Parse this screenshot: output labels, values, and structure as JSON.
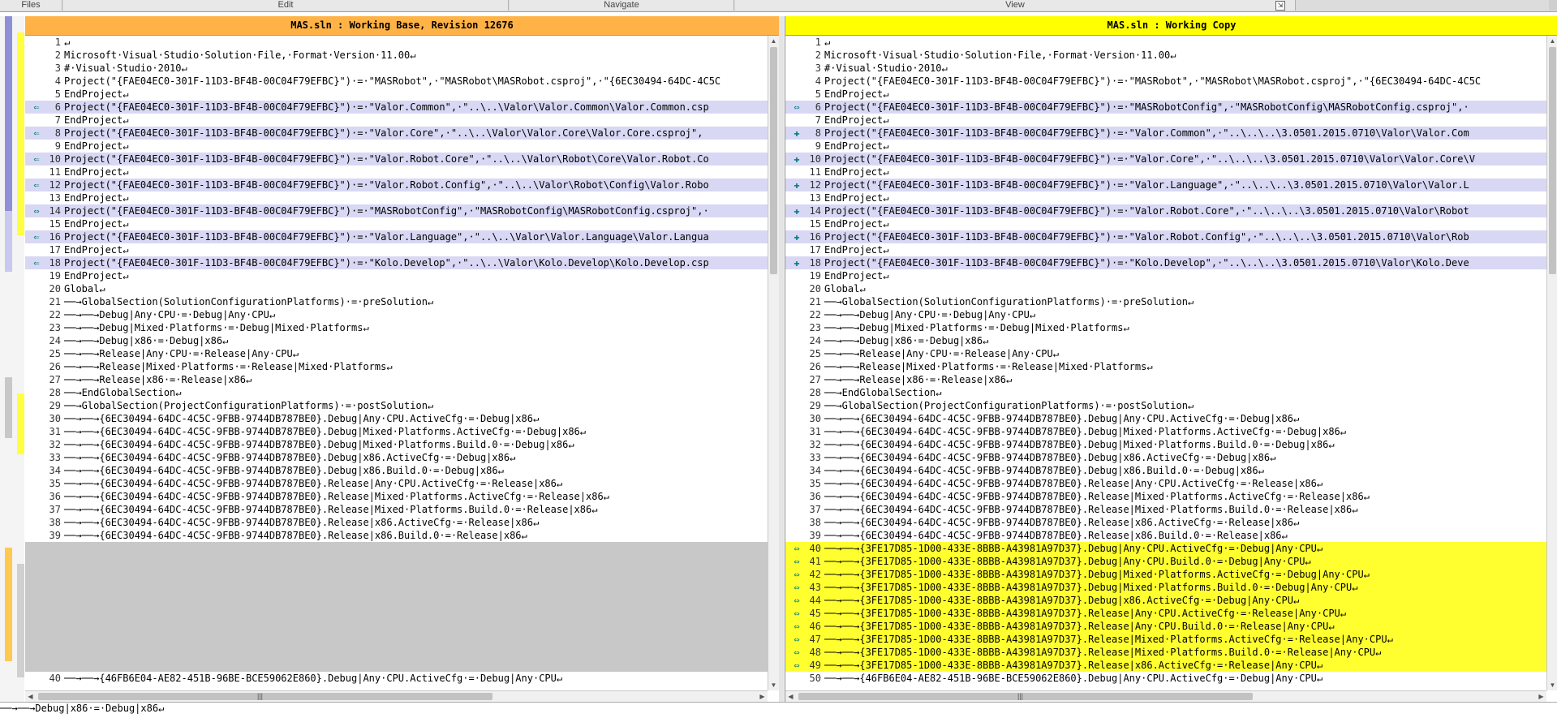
{
  "toolbar": {
    "groups": [
      {
        "label": "Files"
      },
      {
        "label": "Edit"
      },
      {
        "label": "Navigate"
      },
      {
        "label": "View"
      }
    ]
  },
  "left": {
    "title": "MAS.sln : Working Base, Revision 12676",
    "header_color": "#ffb347",
    "lines": [
      {
        "n": "1",
        "t": "↵",
        "k": ""
      },
      {
        "n": "2",
        "t": "Microsoft·Visual·Studio·Solution·File,·Format·Version·11.00↵",
        "k": ""
      },
      {
        "n": "3",
        "t": "#·Visual·Studio·2010↵",
        "k": ""
      },
      {
        "n": "4",
        "t": "Project(\"{FAE04EC0-301F-11D3-BF4B-00C04F79EFBC}\")·=·\"MASRobot\",·\"MASRobot\\MASRobot.csproj\",·\"{6EC30494-64DC-4C5C",
        "k": ""
      },
      {
        "n": "5",
        "t": "EndProject↵",
        "k": ""
      },
      {
        "n": "6",
        "t": "Project(\"{FAE04EC0-301F-11D3-BF4B-00C04F79EFBC}\")·=·\"Valor.Common\",·\"..\\..\\Valor\\Valor.Common\\Valor.Common.csp",
        "k": "mod",
        "g": "⇐"
      },
      {
        "n": "7",
        "t": "EndProject↵",
        "k": ""
      },
      {
        "n": "8",
        "t": "Project(\"{FAE04EC0-301F-11D3-BF4B-00C04F79EFBC}\")·=·\"Valor.Core\",·\"..\\..\\Valor\\Valor.Core\\Valor.Core.csproj\",",
        "k": "mod",
        "g": "⇐"
      },
      {
        "n": "9",
        "t": "EndProject↵",
        "k": ""
      },
      {
        "n": "10",
        "t": "Project(\"{FAE04EC0-301F-11D3-BF4B-00C04F79EFBC}\")·=·\"Valor.Robot.Core\",·\"..\\..\\Valor\\Robot\\Core\\Valor.Robot.Co",
        "k": "mod",
        "g": "⇐"
      },
      {
        "n": "11",
        "t": "EndProject↵",
        "k": ""
      },
      {
        "n": "12",
        "t": "Project(\"{FAE04EC0-301F-11D3-BF4B-00C04F79EFBC}\")·=·\"Valor.Robot.Config\",·\"..\\..\\Valor\\Robot\\Config\\Valor.Robo",
        "k": "mod",
        "g": "⇐"
      },
      {
        "n": "13",
        "t": "EndProject↵",
        "k": ""
      },
      {
        "n": "14",
        "t": "Project(\"{FAE04EC0-301F-11D3-BF4B-00C04F79EFBC}\")·=·\"MASRobotConfig\",·\"MASRobotConfig\\MASRobotConfig.csproj\",·",
        "k": "mod",
        "g": "⇔"
      },
      {
        "n": "15",
        "t": "EndProject↵",
        "k": ""
      },
      {
        "n": "16",
        "t": "Project(\"{FAE04EC0-301F-11D3-BF4B-00C04F79EFBC}\")·=·\"Valor.Language\",·\"..\\..\\Valor\\Valor.Language\\Valor.Langua",
        "k": "mod",
        "g": "⇐"
      },
      {
        "n": "17",
        "t": "EndProject↵",
        "k": ""
      },
      {
        "n": "18",
        "t": "Project(\"{FAE04EC0-301F-11D3-BF4B-00C04F79EFBC}\")·=·\"Kolo.Develop\",·\"..\\..\\Valor\\Kolo.Develop\\Kolo.Develop.csp",
        "k": "mod",
        "g": "⇐"
      },
      {
        "n": "19",
        "t": "EndProject↵",
        "k": ""
      },
      {
        "n": "20",
        "t": "Global↵",
        "k": ""
      },
      {
        "n": "21",
        "t": "──→GlobalSection(SolutionConfigurationPlatforms)·=·preSolution↵",
        "k": ""
      },
      {
        "n": "22",
        "t": "──→──→Debug|Any·CPU·=·Debug|Any·CPU↵",
        "k": ""
      },
      {
        "n": "23",
        "t": "──→──→Debug|Mixed·Platforms·=·Debug|Mixed·Platforms↵",
        "k": ""
      },
      {
        "n": "24",
        "t": "──→──→Debug|x86·=·Debug|x86↵",
        "k": ""
      },
      {
        "n": "25",
        "t": "──→──→Release|Any·CPU·=·Release|Any·CPU↵",
        "k": ""
      },
      {
        "n": "26",
        "t": "──→──→Release|Mixed·Platforms·=·Release|Mixed·Platforms↵",
        "k": ""
      },
      {
        "n": "27",
        "t": "──→──→Release|x86·=·Release|x86↵",
        "k": ""
      },
      {
        "n": "28",
        "t": "──→EndGlobalSection↵",
        "k": ""
      },
      {
        "n": "29",
        "t": "──→GlobalSection(ProjectConfigurationPlatforms)·=·postSolution↵",
        "k": ""
      },
      {
        "n": "30",
        "t": "──→──→{6EC30494-64DC-4C5C-9FBB-9744DB787BE0}.Debug|Any·CPU.ActiveCfg·=·Debug|x86↵",
        "k": ""
      },
      {
        "n": "31",
        "t": "──→──→{6EC30494-64DC-4C5C-9FBB-9744DB787BE0}.Debug|Mixed·Platforms.ActiveCfg·=·Debug|x86↵",
        "k": ""
      },
      {
        "n": "32",
        "t": "──→──→{6EC30494-64DC-4C5C-9FBB-9744DB787BE0}.Debug|Mixed·Platforms.Build.0·=·Debug|x86↵",
        "k": ""
      },
      {
        "n": "33",
        "t": "──→──→{6EC30494-64DC-4C5C-9FBB-9744DB787BE0}.Debug|x86.ActiveCfg·=·Debug|x86↵",
        "k": ""
      },
      {
        "n": "34",
        "t": "──→──→{6EC30494-64DC-4C5C-9FBB-9744DB787BE0}.Debug|x86.Build.0·=·Debug|x86↵",
        "k": ""
      },
      {
        "n": "35",
        "t": "──→──→{6EC30494-64DC-4C5C-9FBB-9744DB787BE0}.Release|Any·CPU.ActiveCfg·=·Release|x86↵",
        "k": ""
      },
      {
        "n": "36",
        "t": "──→──→{6EC30494-64DC-4C5C-9FBB-9744DB787BE0}.Release|Mixed·Platforms.ActiveCfg·=·Release|x86↵",
        "k": ""
      },
      {
        "n": "37",
        "t": "──→──→{6EC30494-64DC-4C5C-9FBB-9744DB787BE0}.Release|Mixed·Platforms.Build.0·=·Release|x86↵",
        "k": ""
      },
      {
        "n": "38",
        "t": "──→──→{6EC30494-64DC-4C5C-9FBB-9744DB787BE0}.Release|x86.ActiveCfg·=·Release|x86↵",
        "k": ""
      },
      {
        "n": "39",
        "t": "──→──→{6EC30494-64DC-4C5C-9FBB-9744DB787BE0}.Release|x86.Build.0·=·Release|x86↵",
        "k": ""
      }
    ],
    "last_line": {
      "n": "40",
      "t": "──→──→{46FB6E04-AE82-451B-96BE-BCE59062E860}.Debug|Any·CPU.ActiveCfg·=·Debug|Any·CPU↵"
    }
  },
  "right": {
    "title": "MAS.sln : Working Copy",
    "header_color": "#ffff00",
    "lines": [
      {
        "n": "1",
        "t": "↵",
        "k": ""
      },
      {
        "n": "2",
        "t": "Microsoft·Visual·Studio·Solution·File,·Format·Version·11.00↵",
        "k": ""
      },
      {
        "n": "3",
        "t": "#·Visual·Studio·2010↵",
        "k": ""
      },
      {
        "n": "4",
        "t": "Project(\"{FAE04EC0-301F-11D3-BF4B-00C04F79EFBC}\")·=·\"MASRobot\",·\"MASRobot\\MASRobot.csproj\",·\"{6EC30494-64DC-4C5C",
        "k": ""
      },
      {
        "n": "5",
        "t": "EndProject↵",
        "k": ""
      },
      {
        "n": "6",
        "t": "Project(\"{FAE04EC0-301F-11D3-BF4B-00C04F79EFBC}\")·=·\"MASRobotConfig\",·\"MASRobotConfig\\MASRobotConfig.csproj\",·",
        "k": "mod",
        "g": "⇔"
      },
      {
        "n": "7",
        "t": "EndProject↵",
        "k": ""
      },
      {
        "n": "8",
        "t": "Project(\"{FAE04EC0-301F-11D3-BF4B-00C04F79EFBC}\")·=·\"Valor.Common\",·\"..\\..\\..\\3.0501.2015.0710\\Valor\\Valor.Com",
        "k": "mod",
        "g": "✚"
      },
      {
        "n": "9",
        "t": "EndProject↵",
        "k": ""
      },
      {
        "n": "10",
        "t": "Project(\"{FAE04EC0-301F-11D3-BF4B-00C04F79EFBC}\")·=·\"Valor.Core\",·\"..\\..\\..\\3.0501.2015.0710\\Valor\\Valor.Core\\V",
        "k": "mod",
        "g": "✚"
      },
      {
        "n": "11",
        "t": "EndProject↵",
        "k": ""
      },
      {
        "n": "12",
        "t": "Project(\"{FAE04EC0-301F-11D3-BF4B-00C04F79EFBC}\")·=·\"Valor.Language\",·\"..\\..\\..\\3.0501.2015.0710\\Valor\\Valor.L",
        "k": "mod",
        "g": "✚"
      },
      {
        "n": "13",
        "t": "EndProject↵",
        "k": ""
      },
      {
        "n": "14",
        "t": "Project(\"{FAE04EC0-301F-11D3-BF4B-00C04F79EFBC}\")·=·\"Valor.Robot.Core\",·\"..\\..\\..\\3.0501.2015.0710\\Valor\\Robot",
        "k": "mod",
        "g": "✚"
      },
      {
        "n": "15",
        "t": "EndProject↵",
        "k": ""
      },
      {
        "n": "16",
        "t": "Project(\"{FAE04EC0-301F-11D3-BF4B-00C04F79EFBC}\")·=·\"Valor.Robot.Config\",·\"..\\..\\..\\3.0501.2015.0710\\Valor\\Rob",
        "k": "mod",
        "g": "✚"
      },
      {
        "n": "17",
        "t": "EndProject↵",
        "k": ""
      },
      {
        "n": "18",
        "t": "Project(\"{FAE04EC0-301F-11D3-BF4B-00C04F79EFBC}\")·=·\"Kolo.Develop\",·\"..\\..\\..\\3.0501.2015.0710\\Valor\\Kolo.Deve",
        "k": "mod",
        "g": "✚"
      },
      {
        "n": "19",
        "t": "EndProject↵",
        "k": ""
      },
      {
        "n": "20",
        "t": "Global↵",
        "k": ""
      },
      {
        "n": "21",
        "t": "──→GlobalSection(SolutionConfigurationPlatforms)·=·preSolution↵",
        "k": ""
      },
      {
        "n": "22",
        "t": "──→──→Debug|Any·CPU·=·Debug|Any·CPU↵",
        "k": ""
      },
      {
        "n": "23",
        "t": "──→──→Debug|Mixed·Platforms·=·Debug|Mixed·Platforms↵",
        "k": ""
      },
      {
        "n": "24",
        "t": "──→──→Debug|x86·=·Debug|x86↵",
        "k": ""
      },
      {
        "n": "25",
        "t": "──→──→Release|Any·CPU·=·Release|Any·CPU↵",
        "k": ""
      },
      {
        "n": "26",
        "t": "──→──→Release|Mixed·Platforms·=·Release|Mixed·Platforms↵",
        "k": ""
      },
      {
        "n": "27",
        "t": "──→──→Release|x86·=·Release|x86↵",
        "k": ""
      },
      {
        "n": "28",
        "t": "──→EndGlobalSection↵",
        "k": ""
      },
      {
        "n": "29",
        "t": "──→GlobalSection(ProjectConfigurationPlatforms)·=·postSolution↵",
        "k": ""
      },
      {
        "n": "30",
        "t": "──→──→{6EC30494-64DC-4C5C-9FBB-9744DB787BE0}.Debug|Any·CPU.ActiveCfg·=·Debug|x86↵",
        "k": ""
      },
      {
        "n": "31",
        "t": "──→──→{6EC30494-64DC-4C5C-9FBB-9744DB787BE0}.Debug|Mixed·Platforms.ActiveCfg·=·Debug|x86↵",
        "k": ""
      },
      {
        "n": "32",
        "t": "──→──→{6EC30494-64DC-4C5C-9FBB-9744DB787BE0}.Debug|Mixed·Platforms.Build.0·=·Debug|x86↵",
        "k": ""
      },
      {
        "n": "33",
        "t": "──→──→{6EC30494-64DC-4C5C-9FBB-9744DB787BE0}.Debug|x86.ActiveCfg·=·Debug|x86↵",
        "k": ""
      },
      {
        "n": "34",
        "t": "──→──→{6EC30494-64DC-4C5C-9FBB-9744DB787BE0}.Debug|x86.Build.0·=·Debug|x86↵",
        "k": ""
      },
      {
        "n": "35",
        "t": "──→──→{6EC30494-64DC-4C5C-9FBB-9744DB787BE0}.Release|Any·CPU.ActiveCfg·=·Release|x86↵",
        "k": ""
      },
      {
        "n": "36",
        "t": "──→──→{6EC30494-64DC-4C5C-9FBB-9744DB787BE0}.Release|Mixed·Platforms.ActiveCfg·=·Release|x86↵",
        "k": ""
      },
      {
        "n": "37",
        "t": "──→──→{6EC30494-64DC-4C5C-9FBB-9744DB787BE0}.Release|Mixed·Platforms.Build.0·=·Release|x86↵",
        "k": ""
      },
      {
        "n": "38",
        "t": "──→──→{6EC30494-64DC-4C5C-9FBB-9744DB787BE0}.Release|x86.ActiveCfg·=·Release|x86↵",
        "k": ""
      },
      {
        "n": "39",
        "t": "──→──→{6EC30494-64DC-4C5C-9FBB-9744DB787BE0}.Release|x86.Build.0·=·Release|x86↵",
        "k": ""
      },
      {
        "n": "40",
        "t": "──→──→{3FE17D85-1D00-433E-8BBB-A43981A97D37}.Debug|Any·CPU.ActiveCfg·=·Debug|Any·CPU↵",
        "k": "add",
        "g": "⇔"
      },
      {
        "n": "41",
        "t": "──→──→{3FE17D85-1D00-433E-8BBB-A43981A97D37}.Debug|Any·CPU.Build.0·=·Debug|Any·CPU↵",
        "k": "add",
        "g": "⇔"
      },
      {
        "n": "42",
        "t": "──→──→{3FE17D85-1D00-433E-8BBB-A43981A97D37}.Debug|Mixed·Platforms.ActiveCfg·=·Debug|Any·CPU↵",
        "k": "add",
        "g": "⇔"
      },
      {
        "n": "43",
        "t": "──→──→{3FE17D85-1D00-433E-8BBB-A43981A97D37}.Debug|Mixed·Platforms.Build.0·=·Debug|Any·CPU↵",
        "k": "add",
        "g": "⇔"
      },
      {
        "n": "44",
        "t": "──→──→{3FE17D85-1D00-433E-8BBB-A43981A97D37}.Debug|x86.ActiveCfg·=·Debug|Any·CPU↵",
        "k": "add",
        "g": "⇔"
      },
      {
        "n": "45",
        "t": "──→──→{3FE17D85-1D00-433E-8BBB-A43981A97D37}.Release|Any·CPU.ActiveCfg·=·Release|Any·CPU↵",
        "k": "add",
        "g": "⇔"
      },
      {
        "n": "46",
        "t": "──→──→{3FE17D85-1D00-433E-8BBB-A43981A97D37}.Release|Any·CPU.Build.0·=·Release|Any·CPU↵",
        "k": "add",
        "g": "⇔"
      },
      {
        "n": "47",
        "t": "──→──→{3FE17D85-1D00-433E-8BBB-A43981A97D37}.Release|Mixed·Platforms.ActiveCfg·=·Release|Any·CPU↵",
        "k": "add",
        "g": "⇔"
      },
      {
        "n": "48",
        "t": "──→──→{3FE17D85-1D00-433E-8BBB-A43981A97D37}.Release|Mixed·Platforms.Build.0·=·Release|Any·CPU↵",
        "k": "add",
        "g": "⇔"
      },
      {
        "n": "49",
        "t": "──→──→{3FE17D85-1D00-433E-8BBB-A43981A97D37}.Release|x86.ActiveCfg·=·Release|Any·CPU↵",
        "k": "add",
        "g": "⇔"
      },
      {
        "n": "50",
        "t": "──→──→{46FB6E04-AE82-451B-96BE-BCE59062E860}.Debug|Any·CPU.ActiveCfg·=·Debug|Any·CPU↵",
        "k": ""
      }
    ]
  },
  "bottom": {
    "text": "──→──→Debug|x86·=·Debug|x86↵"
  },
  "colors": {
    "modified": "#d8d8f4",
    "added": "#ffff30",
    "deleted": "#e07b7b",
    "gap": "#c8c8c8",
    "gutter_icon": "#008080"
  }
}
